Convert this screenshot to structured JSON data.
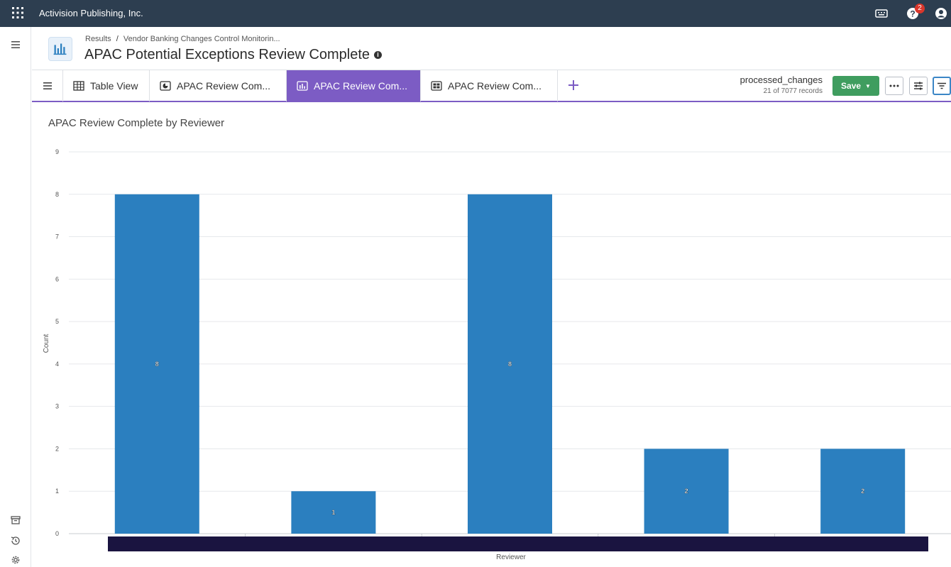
{
  "topbar": {
    "company": "Activision Publishing, Inc.",
    "help_badge": "2"
  },
  "header": {
    "breadcrumb_root": "Results",
    "breadcrumb_sep": "/",
    "breadcrumb_item": "Vendor Banking Changes Control Monitorin...",
    "title": "APAC Potential Exceptions Review Complete"
  },
  "tabs": [
    {
      "label": "Table View",
      "icon": "table-icon"
    },
    {
      "label": "APAC Review Com...",
      "icon": "pie-chart-icon"
    },
    {
      "label": "APAC Review Com...",
      "icon": "bar-chart-icon"
    },
    {
      "label": "APAC Review Com...",
      "icon": "dashboard-icon"
    }
  ],
  "active_tab": 2,
  "dataset": {
    "name": "processed_changes",
    "records": "21 of 7077 records"
  },
  "toolbar": {
    "save_label": "Save",
    "more_label": "···"
  },
  "colors": {
    "bar": "#2b7fbf",
    "accent": "#7c5cc4",
    "save": "#3f9d5f",
    "topbar": "#2d3e50",
    "axis_band": "#1a1440"
  },
  "chart_data": {
    "type": "bar",
    "title": "APAC Review Complete by Reviewer",
    "xlabel": "Reviewer",
    "ylabel": "Count",
    "categories": [
      "",
      "",
      "",
      "",
      ""
    ],
    "values": [
      8,
      1,
      8,
      2,
      2
    ],
    "data_labels": [
      "8",
      "1",
      "8",
      "2",
      "2"
    ],
    "ylim": [
      0,
      9
    ],
    "yticks": [
      "0",
      "1",
      "2",
      "3",
      "4",
      "5",
      "6",
      "7",
      "8",
      "9"
    ],
    "grid": true
  }
}
